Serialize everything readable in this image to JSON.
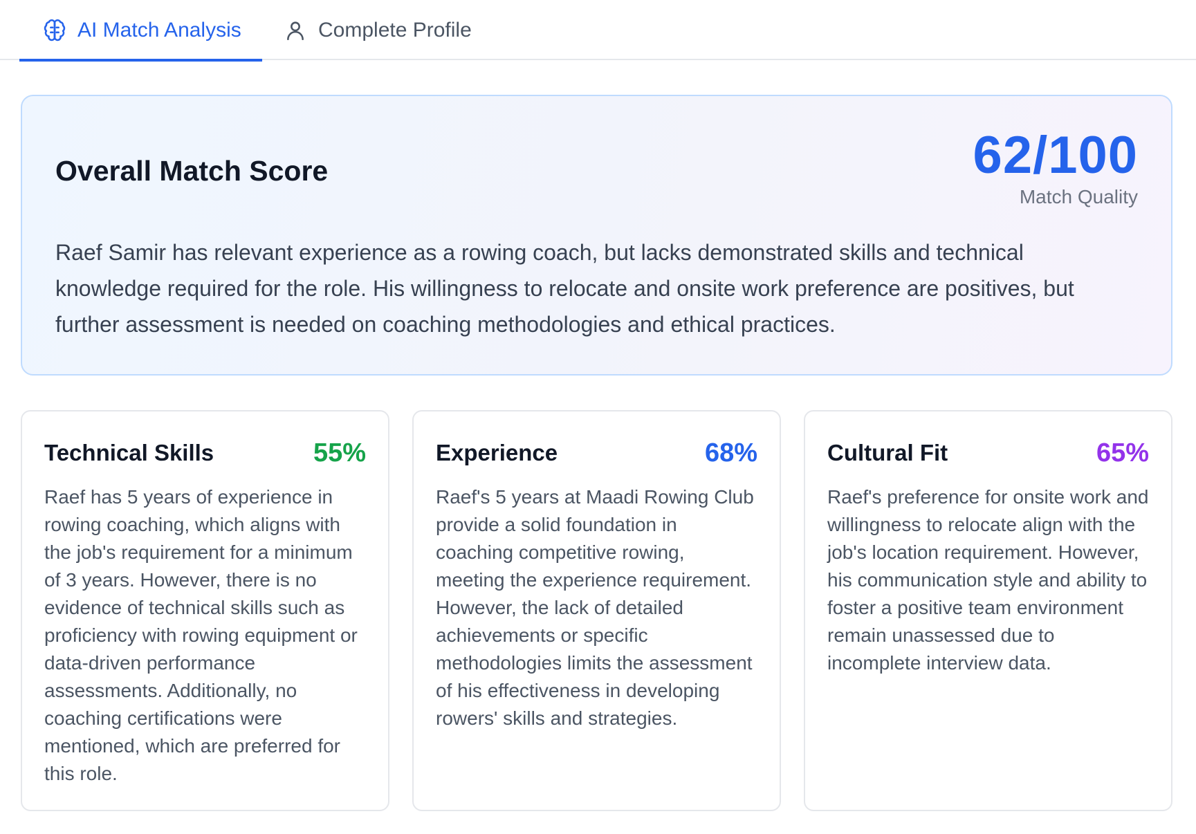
{
  "tabs": [
    {
      "label": "AI Match Analysis",
      "icon": "brain-icon",
      "active": true
    },
    {
      "label": "Complete Profile",
      "icon": "user-icon",
      "active": false
    }
  ],
  "overall": {
    "title": "Overall Match Score",
    "score": "62/100",
    "score_label": "Match Quality",
    "summary": "Raef Samir has relevant experience as a rowing coach, but lacks demonstrated skills and technical knowledge required for the role. His willingness to relocate and onsite work preference are positives, but further assessment is needed on coaching methodologies and ethical practices."
  },
  "cards": [
    {
      "title": "Technical Skills",
      "percent": "55%",
      "color": "#16a34a",
      "body": "Raef has 5 years of experience in rowing coaching, which aligns with the job's requirement for a minimum of 3 years. However, there is no evidence of technical skills such as proficiency with rowing equipment or data-driven performance assessments. Additionally, no coaching certifications were mentioned, which are preferred for this role."
    },
    {
      "title": "Experience",
      "percent": "68%",
      "color": "#2563eb",
      "body": "Raef's 5 years at Maadi Rowing Club provide a solid foundation in coaching competitive rowing, meeting the experience requirement. However, the lack of detailed achievements or specific methodologies limits the assessment of his effectiveness in developing rowers' skills and strategies."
    },
    {
      "title": "Cultural Fit",
      "percent": "65%",
      "color": "#9333ea",
      "body": "Raef's preference for onsite work and willingness to relocate align with the job's location requirement. However, his communication style and ability to foster a positive team environment remain unassessed due to incomplete interview data."
    }
  ]
}
